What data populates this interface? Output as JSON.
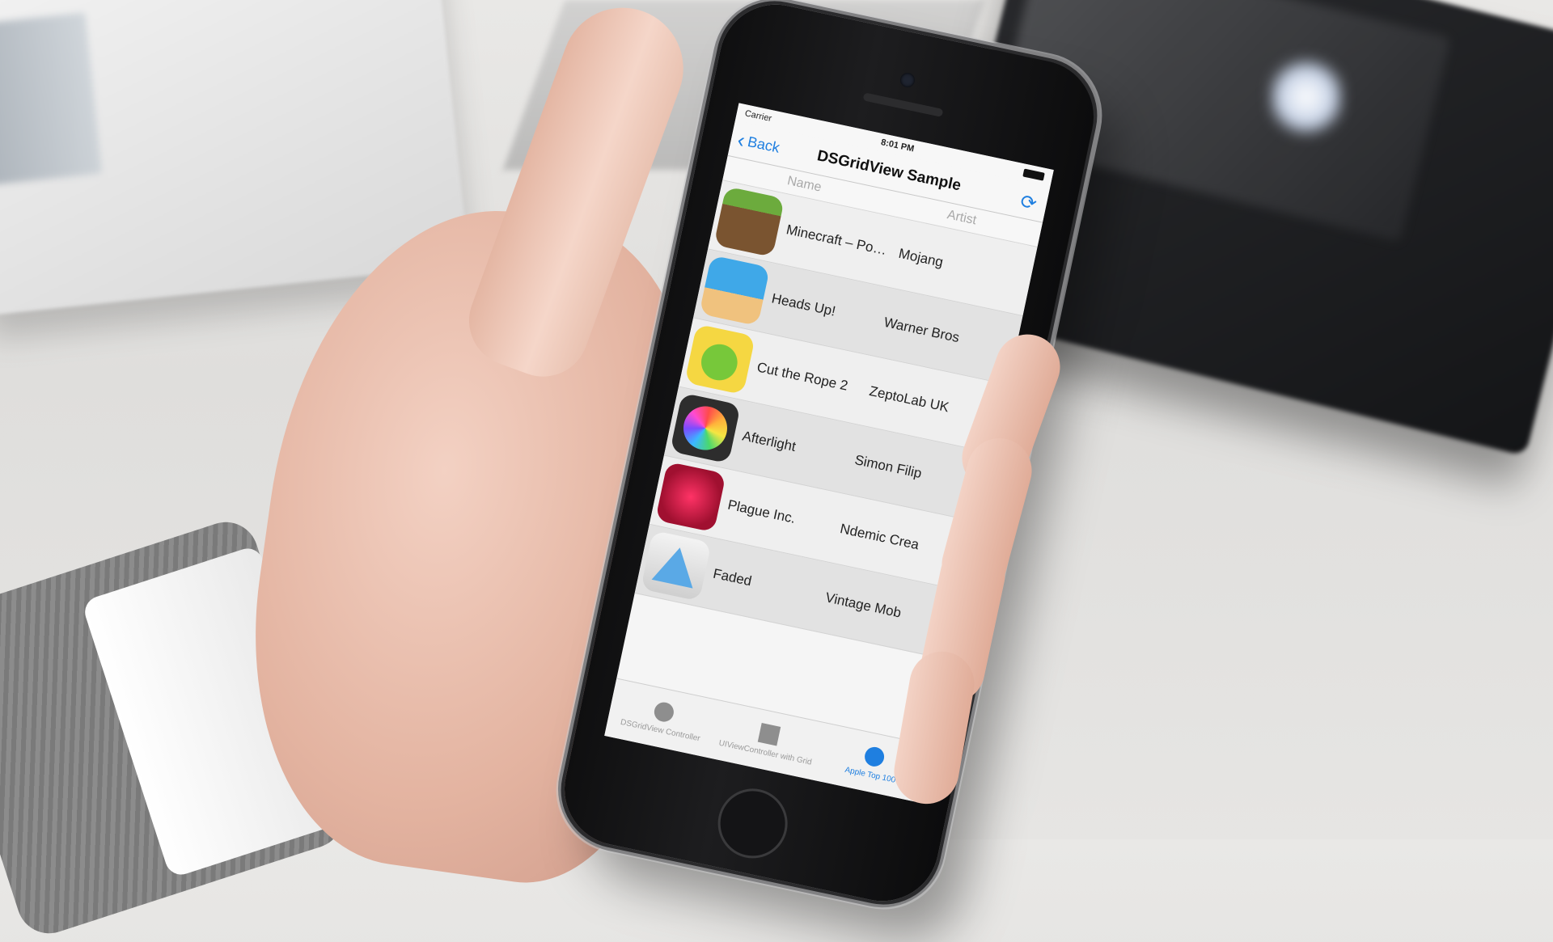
{
  "status_bar": {
    "carrier": "Carrier",
    "time": "8:01 PM"
  },
  "navbar": {
    "back_label": "Back",
    "title": "DSGridView Sample",
    "refresh_icon": "refresh-icon"
  },
  "table": {
    "columns": {
      "name": "Name",
      "artist": "Artist"
    },
    "rows": [
      {
        "name": "Minecraft – Pock…",
        "artist": "Mojang",
        "icon": "minecraft-icon"
      },
      {
        "name": "Heads Up!",
        "artist": "Warner Bros",
        "icon": "heads-up-icon"
      },
      {
        "name": "Cut the Rope 2",
        "artist": "ZeptoLab UK",
        "icon": "cut-the-rope-icon"
      },
      {
        "name": "Afterlight",
        "artist": "Simon Filip",
        "icon": "afterlight-icon"
      },
      {
        "name": "Plague Inc.",
        "artist": "Ndemic Crea",
        "icon": "plague-icon"
      },
      {
        "name": "Faded",
        "artist": "Vintage Mob",
        "icon": "faded-icon"
      }
    ]
  },
  "tab_bar": {
    "tabs": [
      {
        "label": "DSGridView Controller"
      },
      {
        "label": "UIViewController with Grid"
      },
      {
        "label": "Apple Top 100"
      }
    ]
  },
  "colors": {
    "accent": "#1f7fe0",
    "row_alt": "#e2e2e2",
    "row_plain": "#efefef"
  }
}
